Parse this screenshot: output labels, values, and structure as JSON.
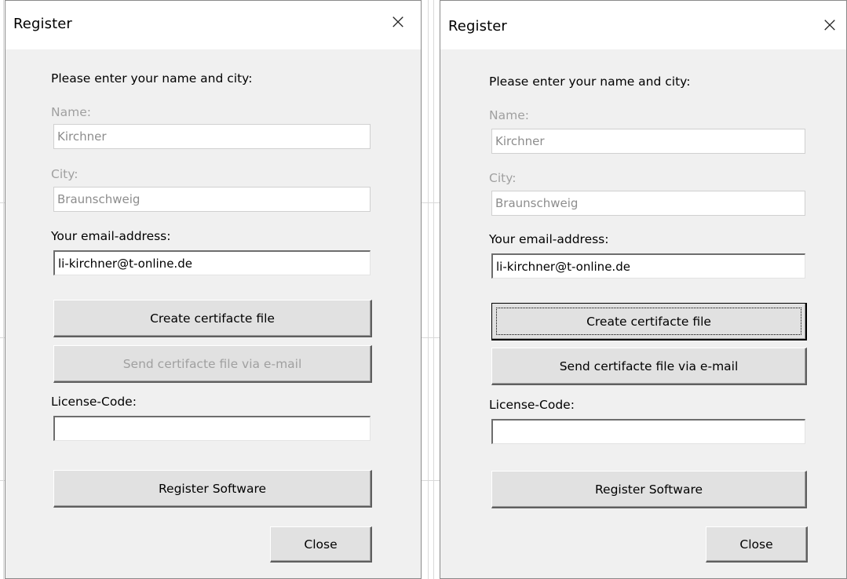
{
  "dialogs": [
    {
      "title": "Register",
      "close_glyph": "×",
      "prompt": "Please enter your name and city:",
      "name_label": "Name:",
      "name_value": "Kirchner",
      "city_label": "City:",
      "city_value": "Braunschweig",
      "email_label": "Your email-address:",
      "email_value": "li-kirchner@t-online.de",
      "create_button": "Create certifacte file",
      "send_button": "Send certifacte file via e-mail",
      "license_label": "License-Code:",
      "license_value": "",
      "register_button": "Register Software",
      "close_button": "Close",
      "send_enabled": false,
      "create_focused": false
    },
    {
      "title": "Register",
      "close_glyph": "×",
      "prompt": "Please enter your name and city:",
      "name_label": "Name:",
      "name_value": "Kirchner",
      "city_label": "City:",
      "city_value": "Braunschweig",
      "email_label": "Your email-address:",
      "email_value": "li-kirchner@t-online.de",
      "create_button": "Create certifacte file",
      "send_button": "Send certifacte file via e-mail",
      "license_label": "License-Code:",
      "license_value": "",
      "register_button": "Register Software",
      "close_button": "Close",
      "send_enabled": true,
      "create_focused": true
    }
  ]
}
